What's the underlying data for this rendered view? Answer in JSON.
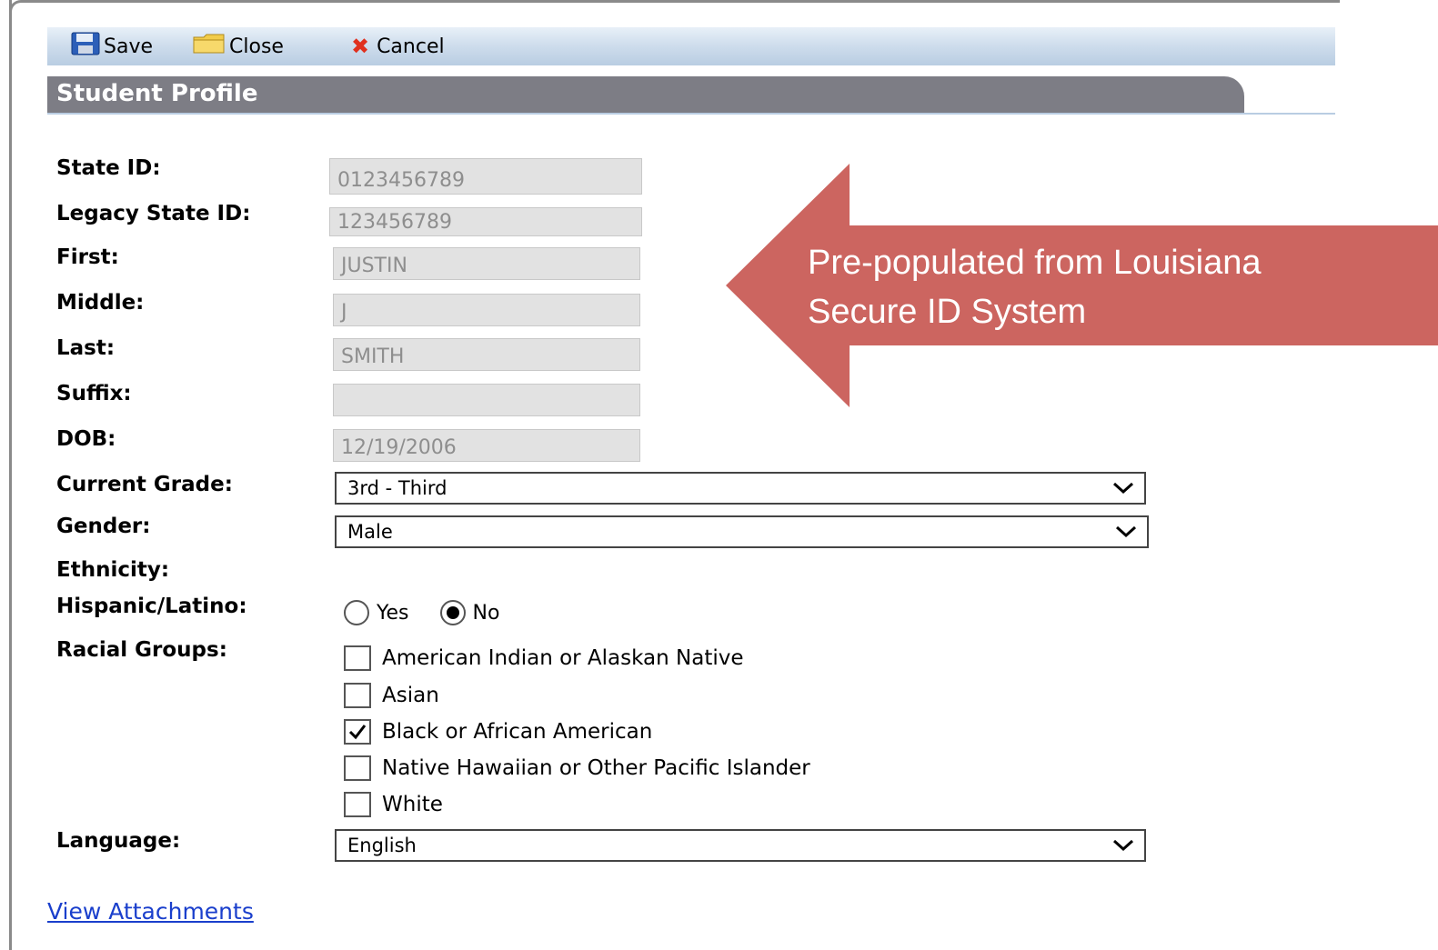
{
  "toolbar": {
    "save_label": "Save",
    "close_label": "Close",
    "cancel_label": "Cancel"
  },
  "header": {
    "title": "Student Profile"
  },
  "fields": {
    "state_id": {
      "label": "State ID:",
      "value": "0123456789"
    },
    "legacy_state_id": {
      "label": "Legacy State ID:",
      "value": "123456789"
    },
    "first": {
      "label": "First:",
      "value": "JUSTIN"
    },
    "middle": {
      "label": "Middle:",
      "value": "J"
    },
    "last": {
      "label": "Last:",
      "value": "SMITH"
    },
    "suffix": {
      "label": "Suffix:",
      "value": ""
    },
    "dob": {
      "label": "DOB:",
      "value": "12/19/2006"
    },
    "current_grade": {
      "label": "Current Grade:",
      "value": "3rd - Third"
    },
    "gender": {
      "label": "Gender:",
      "value": "Male"
    },
    "ethnicity": {
      "label": "Ethnicity:"
    },
    "hispanic": {
      "label": "Hispanic/Latino:",
      "options": [
        "Yes",
        "No"
      ],
      "selected": "No"
    },
    "racial_groups": {
      "label": "Racial Groups:",
      "options": [
        {
          "label": "American Indian or Alaskan Native",
          "checked": false
        },
        {
          "label": "Asian",
          "checked": false
        },
        {
          "label": "Black or African American",
          "checked": true
        },
        {
          "label": "Native Hawaiian or Other Pacific Islander",
          "checked": false
        },
        {
          "label": "White",
          "checked": false
        }
      ]
    },
    "language": {
      "label": "Language:",
      "value": "English"
    }
  },
  "links": {
    "view_attachments": "View Attachments"
  },
  "callout": {
    "line1": "Pre-populated from Louisiana",
    "line2": "Secure ID System",
    "color": "#cc6560"
  }
}
